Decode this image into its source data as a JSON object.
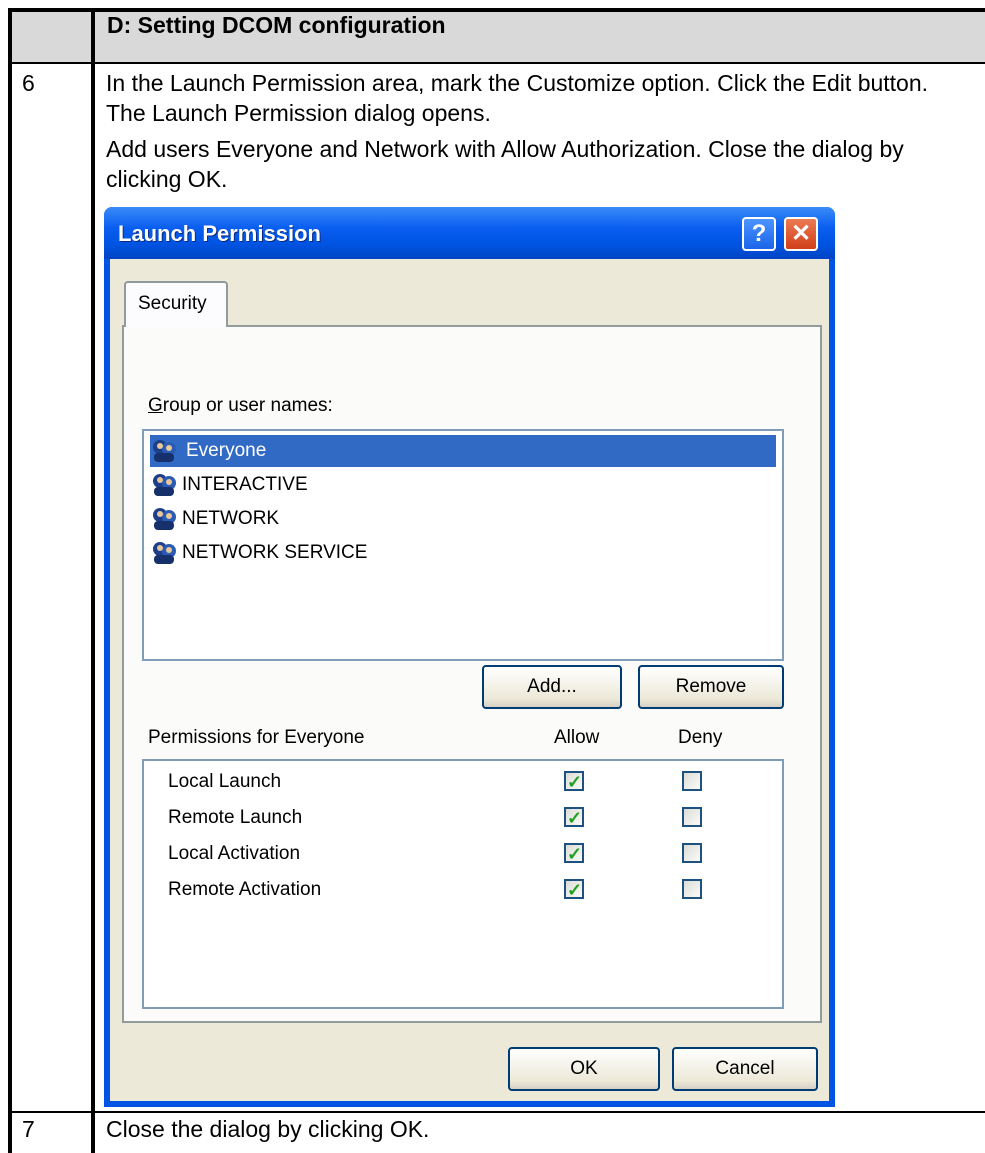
{
  "document": {
    "section_title": "D: Setting DCOM configuration",
    "steps": [
      {
        "number": "6",
        "paragraphs": [
          "In the Launch Permission area, mark the Customize option. Click the Edit button. The Launch Permission dialog opens.",
          "Add users Everyone and Network with Allow Authorization. Close the dialog by clicking OK."
        ]
      },
      {
        "number": "7",
        "paragraphs": [
          "Close the dialog by clicking OK."
        ]
      }
    ]
  },
  "dialog": {
    "title": "Launch Permission",
    "help_glyph": "?",
    "close_glyph": "✕",
    "tab_label": "Security",
    "group_label": "Group or user names:",
    "users": [
      {
        "name": "Everyone",
        "selected": true
      },
      {
        "name": "INTERACTIVE",
        "selected": false
      },
      {
        "name": "NETWORK",
        "selected": false
      },
      {
        "name": "NETWORK SERVICE",
        "selected": false
      }
    ],
    "add_button": "Add...",
    "remove_button": "Remove",
    "permissions_label": "Permissions for Everyone",
    "allow_header": "Allow",
    "deny_header": "Deny",
    "permissions": [
      {
        "name": "Local Launch",
        "allow": true,
        "deny": false
      },
      {
        "name": "Remote Launch",
        "allow": true,
        "deny": false
      },
      {
        "name": "Local Activation",
        "allow": true,
        "deny": false
      },
      {
        "name": "Remote Activation",
        "allow": true,
        "deny": false
      }
    ],
    "ok_button": "OK",
    "cancel_button": "Cancel",
    "icon": "user-group-icon"
  }
}
